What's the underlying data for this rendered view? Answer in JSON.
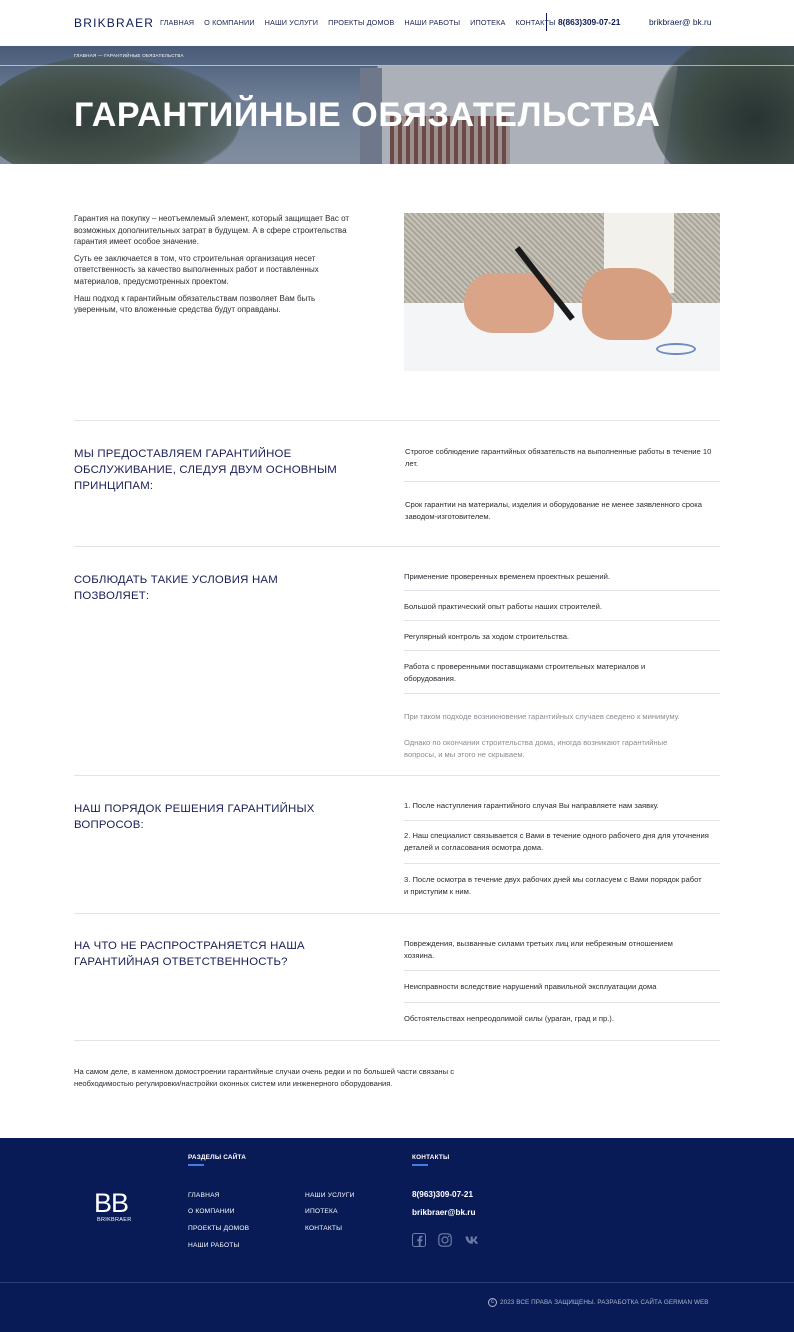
{
  "header": {
    "logo": "BRIKBRAER",
    "nav": [
      "ГЛАВНАЯ",
      "О КОМПАНИИ",
      "НАШИ УСЛУГИ",
      "ПРОЕКТЫ ДОМОВ",
      "НАШИ РАБОТЫ",
      "ИПОТЕКА",
      "КОНТАКТЫ"
    ],
    "phone": "8(863)309-07-21",
    "email": "brikbraer@ bk.ru"
  },
  "hero": {
    "breadcrumb": "ГЛАВНАЯ — ГАРАНТИЙНЫЕ ОБЯЗАТЕЛЬСТВА",
    "title": "ГАРАНТИЙНЫЕ ОБЯЗАТЕЛЬСТВА"
  },
  "intro": {
    "p1": "Гарантия на покупку – неотъемлемый элемент, который защищает Вас от возможных дополнительных затрат в будущем. А в сфере строительства гарантия имеет особое значение.",
    "p2": "Суть ее заключается в том, что строительная организация несет ответственность за качество выполненных работ и поставленных материалов, предусмотренных проектом.",
    "p3": "Наш подход к гарантийным обязательствам позволяет Вам быть уверенным, что вложенные средства будут оправданы."
  },
  "sections": [
    {
      "title": "МЫ ПРЕДОСТАВЛЯЕМ ГАРАНТИЙНОЕ ОБСЛУЖИВАНИЕ, СЛЕДУЯ ДВУМ ОСНОВНЫМ ПРИНЦИПАМ:",
      "items": [
        "Строгое соблюдение гарантийных обязательств на выполненные работы в течение 10 лет.",
        "Срок гарантии на материалы, изделия и оборудование не менее заявленного срока заводом-изготовителем."
      ]
    },
    {
      "title": "СОБЛЮДАТЬ ТАКИЕ УСЛОВИЯ НАМ ПОЗВОЛЯЕТ:",
      "items": [
        "Применение проверенных временем проектных решений.",
        "Большой практический опыт работы наших строителей.",
        "Регулярный контроль за ходом строительства.",
        "Работа с проверенными поставщиками строительных материалов и оборудования."
      ],
      "notes": [
        "При таком подходе возникновение гарантийных случаев сведено к минимуму.",
        "Однако по окончании строительства дома, иногда возникают гарантийные вопросы, и мы этого не скрываем."
      ]
    },
    {
      "title": "НАШ ПОРЯДОК РЕШЕНИЯ ГАРАНТИЙНЫХ ВОПРОСОВ:",
      "items": [
        " 1. После наступления гарантийного случая Вы направляете нам заявку.",
        " 2. Наш специалист связывается с Вами в течение одного рабочего дня для уточнения деталей и согласования осмотра дома.",
        "3. После осмотра в течение двух рабочих дней мы согласуем с Вами порядок работ и приступим к ним."
      ]
    },
    {
      "title": "НА ЧТО НЕ РАСПРОСТРАНЯЕТСЯ НАША ГАРАНТИЙНАЯ ОТВЕТСТВЕННОСТЬ?",
      "items": [
        "Повреждения, вызванные силами третьих лиц или небрежным отношением хозяина.",
        "Неисправности вследствие нарушений правильной эксплуатации дома",
        "Обстоятельствах непреодолимой силы (ураган, град и пр.)."
      ]
    }
  ],
  "outro": "На самом деле, в каменном домостроении гарантийные случаи очень редки и по большей части связаны с необходимостью регулировки/настройки оконных систем или инженерного оборудования.",
  "footer": {
    "logo_mark": "BB",
    "logo_text": "BRIKBRAER",
    "sections_heading": "РАЗДЕЛЫ САЙТА",
    "links_col1": [
      "ГЛАВНАЯ",
      "О КОМПАНИИ",
      "ПРОЕКТЫ ДОМОВ",
      "НАШИ РАБОТЫ"
    ],
    "links_col2": [
      "НАШИ УСЛУГИ",
      "ИПОТЕКА",
      "КОНТАКТЫ"
    ],
    "contacts_heading": "КОНТАКТЫ",
    "phone": "8(963)309-07-21",
    "email": "brikbraer@bk.ru",
    "social_icons": [
      "facebook-icon",
      "instagram-icon",
      "vk-icon"
    ],
    "copyright": "2023 ВСЕ ПРАВА ЗАЩИЩЕНЫ. РАЗРАБОТКА САЙТА GERMAN  WEB"
  },
  "colors": {
    "navy": "#081b56",
    "heading": "#1a1f55",
    "accent": "#3f7fe3"
  }
}
